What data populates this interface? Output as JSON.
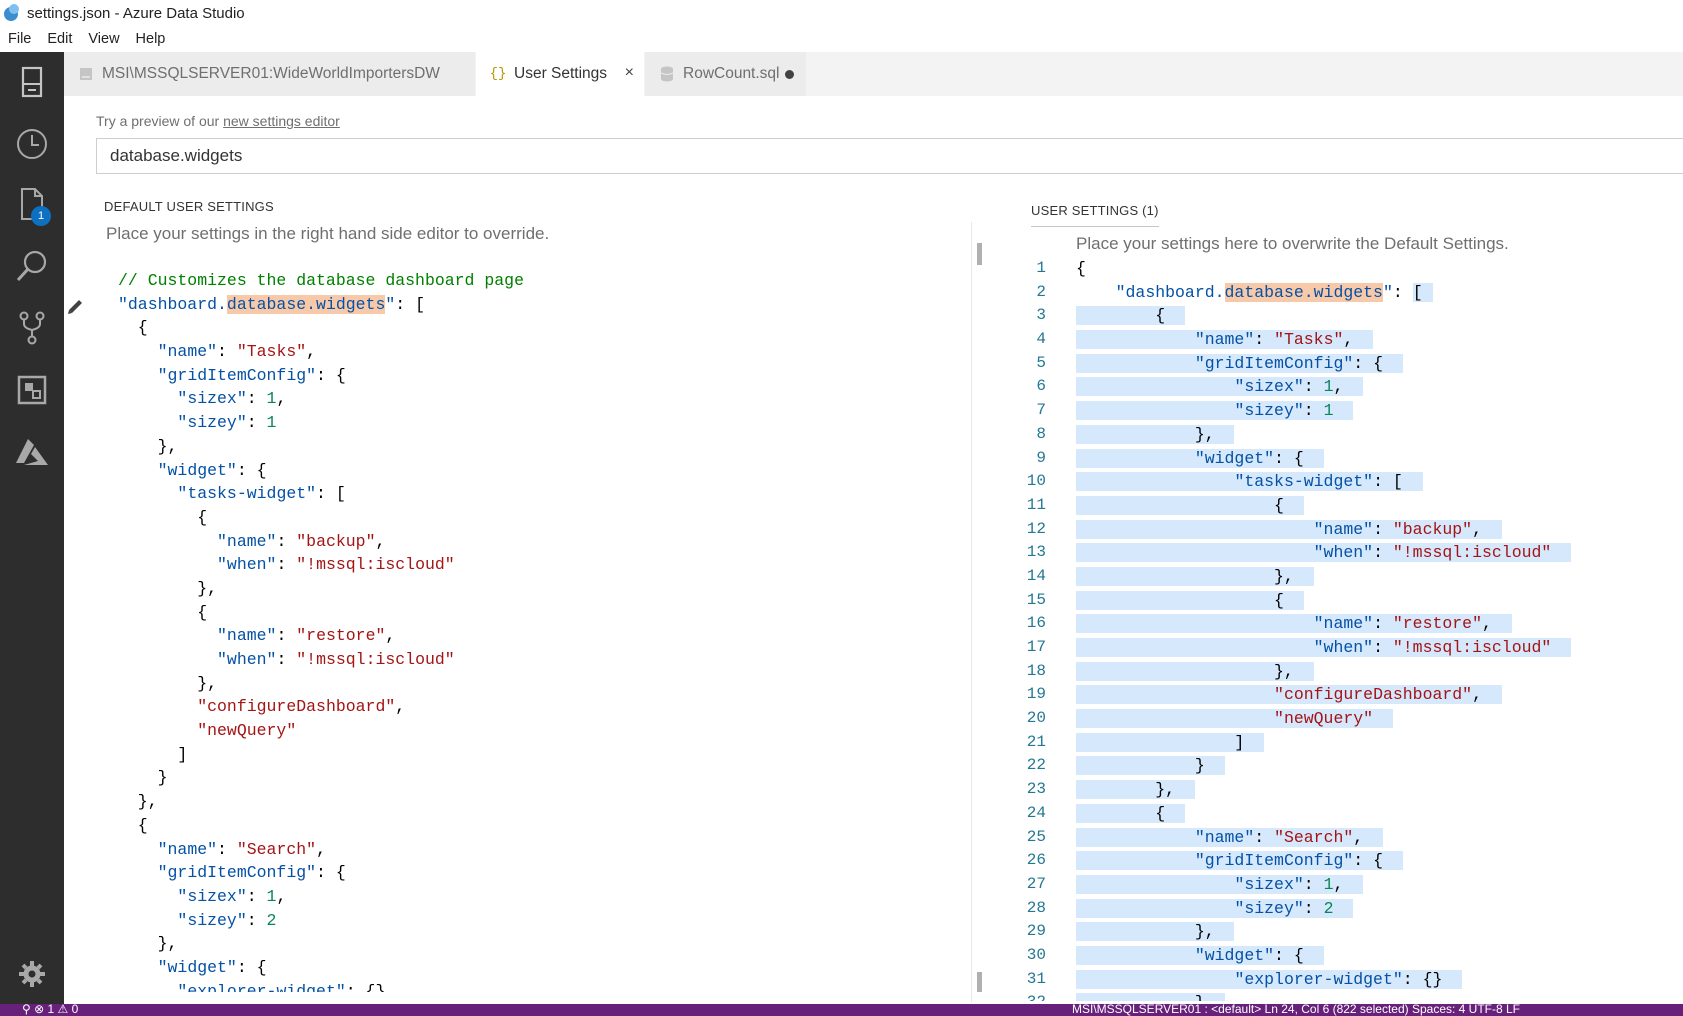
{
  "window": {
    "title": "settings.json - Azure Data Studio"
  },
  "menu": [
    "File",
    "Edit",
    "View",
    "Help"
  ],
  "activity_bar": {
    "items": [
      "servers-icon",
      "history-icon",
      "explorer-icon",
      "search-icon",
      "source-control-icon",
      "extensions-icon",
      "azure-icon"
    ],
    "explorer_badge": "1",
    "settings_icon": "gear-icon"
  },
  "tabs": [
    {
      "label": "MSI\\MSSQLSERVER01:WideWorldImportersDW",
      "icon": "server-icon",
      "state": "inactive"
    },
    {
      "label": "User Settings",
      "icon": "braces-icon",
      "state": "active",
      "close": "×"
    },
    {
      "label": "RowCount.sql",
      "icon": "database-icon",
      "state": "dirty"
    }
  ],
  "settings": {
    "hint_prefix": "Try a preview of our ",
    "hint_link": "new settings editor",
    "search_value": "database.widgets"
  },
  "left_editor": {
    "header": "DEFAULT USER SETTINGS",
    "description": "Place your settings in the right hand side editor to override."
  },
  "right_editor": {
    "header": "USER SETTINGS (1)",
    "description": "Place your settings here to overwrite the Default Settings."
  },
  "status_bar": {
    "left": "⚲  ⊗ 1 ⚠ 0",
    "right": "MSI\\MSSQLSERVER01 : <default>    Ln 24, Col 6 (822 selected)    Spaces: 4    UTF-8    LF"
  }
}
